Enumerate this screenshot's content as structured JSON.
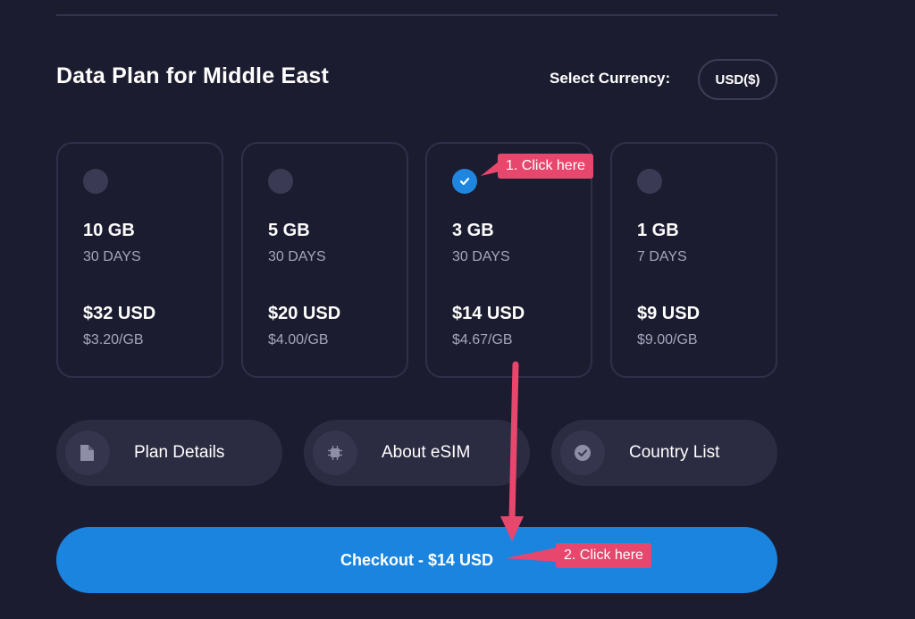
{
  "title": "Data Plan for Middle East",
  "currency": {
    "label": "Select Currency:",
    "value": "USD($)"
  },
  "plans": [
    {
      "data": "10 GB",
      "days": "30 DAYS",
      "price": "$32 USD",
      "per_gb": "$3.20/GB",
      "selected": false
    },
    {
      "data": "5 GB",
      "days": "30 DAYS",
      "price": "$20 USD",
      "per_gb": "$4.00/GB",
      "selected": false
    },
    {
      "data": "3 GB",
      "days": "30 DAYS",
      "price": "$14 USD",
      "per_gb": "$4.67/GB",
      "selected": true
    },
    {
      "data": "1 GB",
      "days": "7 DAYS",
      "price": "$9 USD",
      "per_gb": "$9.00/GB",
      "selected": false
    }
  ],
  "info_buttons": [
    {
      "label": "Plan Details",
      "icon": "document-icon"
    },
    {
      "label": "About eSIM",
      "icon": "chip-icon"
    },
    {
      "label": "Country List",
      "icon": "check-circle-icon"
    }
  ],
  "checkout": {
    "label": "Checkout - $14 USD"
  },
  "annotations": {
    "step1": "1. Click here",
    "step2": "2. Click here"
  },
  "colors": {
    "background": "#1c1c31",
    "accent_blue": "#1a84df",
    "annotation_pink": "#e8476d"
  }
}
